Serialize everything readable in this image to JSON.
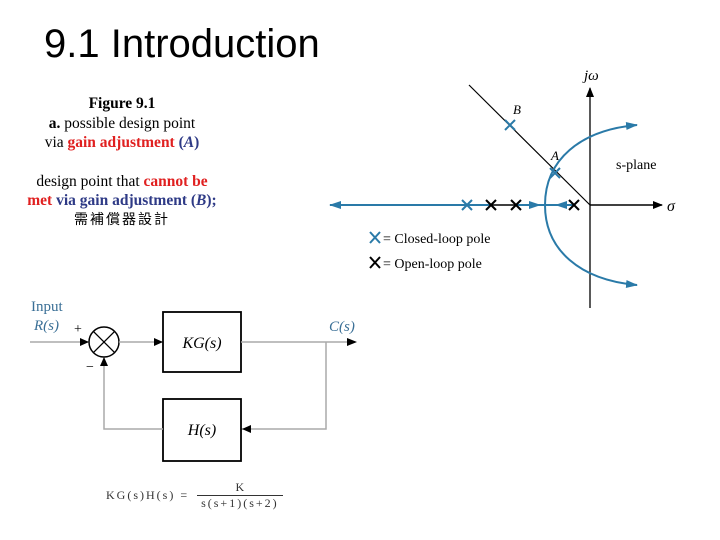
{
  "title": "9.1 Introduction",
  "caption": {
    "fig_label": "Figure 9.1",
    "line_a_prefix": "a.",
    "line_a_text": " possible design point",
    "line_via": "via ",
    "gain_adjustment": "gain adjustment",
    "point_a_open": " (",
    "point_a": "A",
    "point_a_close": ")",
    "line_b_text": "design point that ",
    "cannot_be_met": "cannot be met",
    "via_gain": " via gain adjustment (",
    "point_b": "B",
    "point_b_close": ");",
    "chinese_note": "需補償器設計"
  },
  "root_locus": {
    "y_axis_label": "jω",
    "x_axis_label": "σ",
    "plane_label": "s-plane",
    "point_a_label": "A",
    "point_b_label": "B",
    "legend": [
      {
        "symbol": "X",
        "color": "#2a7aa8",
        "text": "= Closed-loop pole"
      },
      {
        "symbol": "X",
        "color": "#000000",
        "text": "= Open-loop pole"
      }
    ],
    "locus_color": "#2a7aa8"
  },
  "block_diagram": {
    "input_label": "Input",
    "input_signal": "R(s)",
    "plus_sign": "+",
    "minus_sign": "−",
    "forward_block": "KG(s)",
    "feedback_block": "H(s)",
    "output_signal": "C(s)",
    "input_color": "#3a6f96"
  },
  "equation": {
    "lhs": "KG(s)H(s) =",
    "numerator": "K",
    "denominator": "s(s+1)(s+2)"
  }
}
